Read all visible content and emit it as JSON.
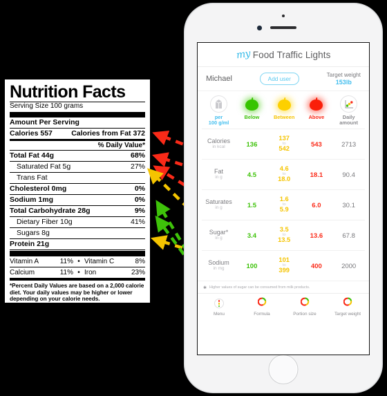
{
  "colors": {
    "green": "#3ec20a",
    "yellow": "#f5c400",
    "red": "#fa2a18",
    "blue": "#40bdee",
    "grey": "#77777b"
  },
  "nutrition_label": {
    "title": "Nutrition Facts",
    "serving_size": "Serving Size  100 grams",
    "amount_per_serving": "Amount Per Serving",
    "calories_label": "Calories 557",
    "calories_from_fat": "Calories from Fat 372",
    "daily_value_header": "% Daily Value*",
    "rows": [
      {
        "label": "Total Fat 44g",
        "dv": "68%",
        "bold": true,
        "indent": false
      },
      {
        "label": "Saturated Fat 5g",
        "dv": "27%",
        "bold": false,
        "indent": true
      },
      {
        "label": "Trans Fat",
        "dv": "",
        "bold": false,
        "indent": true
      },
      {
        "label": "Cholesterol 0mg",
        "dv": "0%",
        "bold": true,
        "indent": false
      },
      {
        "label": "Sodium 1mg",
        "dv": "0%",
        "bold": true,
        "indent": false
      },
      {
        "label": "Total Carbohydrate 28g",
        "dv": "9%",
        "bold": true,
        "indent": false
      },
      {
        "label": "Dietary Fiber 10g",
        "dv": "41%",
        "bold": false,
        "indent": true
      },
      {
        "label": "Sugars 8g",
        "dv": "",
        "bold": false,
        "indent": true
      },
      {
        "label": "Protein 21g",
        "dv": "",
        "bold": true,
        "indent": false
      }
    ],
    "vitamins": [
      {
        "name": "Vitamin A",
        "value": "11%",
        "name2": "Vitamin C",
        "value2": "8%"
      },
      {
        "name": "Calcium",
        "value": "11%",
        "name2": "Iron",
        "value2": "23%"
      }
    ],
    "footnote": "*Percent Daily Values are based on a 2,000 calorie diet. Your daily values may be higher or lower depending on your calorie needs."
  },
  "app": {
    "logo_text": "my",
    "title": "Food Traffic Lights",
    "user_name": "Michael",
    "add_user_label": "Add user",
    "target_weight_label": "Target weight",
    "target_weight_value": "153lb",
    "columns": [
      {
        "label": "per\n100 g/ml",
        "label_line1": "per",
        "label_line2": "100 g/ml",
        "icon": "milk-carton-icon"
      },
      {
        "label": "Below",
        "icon": "green-apple-icon"
      },
      {
        "label": "Between",
        "icon": "yellow-apple-icon"
      },
      {
        "label": "Above",
        "icon": "red-apple-icon"
      },
      {
        "label_line1": "Daily",
        "label_line2": "amount",
        "icon": "chart-icon"
      }
    ],
    "rows": [
      {
        "name": "Calories",
        "unit": "in kcal",
        "below": "136",
        "between_low": "137",
        "between_sep": "to",
        "between_high": "542",
        "above": "543",
        "daily": "2713"
      },
      {
        "name": "Fat",
        "unit": "in g",
        "below": "4.5",
        "between_low": "4.6",
        "between_sep": "to",
        "between_high": "18.0",
        "above": "18.1",
        "daily": "90.4"
      },
      {
        "name": "Saturates",
        "unit": "in g",
        "below": "1.5",
        "between_low": "1.6",
        "between_sep": "to",
        "between_high": "5.9",
        "above": "6.0",
        "daily": "30.1"
      },
      {
        "name": "Sugar*",
        "unit": "in g",
        "below": "3.4",
        "between_low": "3.5",
        "between_sep": "to",
        "between_high": "13.5",
        "above": "13.6",
        "daily": "67.8"
      },
      {
        "name": "Sodium",
        "unit": "in mg",
        "below": "100",
        "between_low": "101",
        "between_sep": "to",
        "between_high": "399",
        "above": "400",
        "daily": "2000"
      }
    ],
    "note": "Higher values of sugar can be consumed from milk products.",
    "tabs": [
      {
        "label": "Menu",
        "icon": "traffic-light-icon"
      },
      {
        "label": "Formula",
        "icon": "ring-icon"
      },
      {
        "label": "Portion size",
        "icon": "ring-icon"
      },
      {
        "label": "Target weight",
        "icon": "ring-icon"
      }
    ]
  }
}
